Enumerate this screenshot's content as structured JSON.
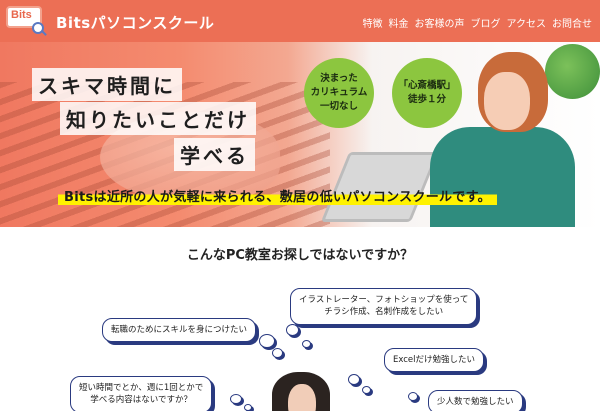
{
  "header": {
    "logo_text": "Bits",
    "title": "Bitsパソコンスクール",
    "nav": [
      "特徴",
      "料金",
      "お客様の声",
      "ブログ",
      "アクセス",
      "お問合せ"
    ]
  },
  "hero": {
    "catch_lines": [
      "スキマ時間に",
      "知りたいことだけ",
      "学べる"
    ],
    "badge1": [
      "決まった",
      "カリキュラム",
      "一切なし"
    ],
    "badge2": [
      "「心斎橋駅」",
      "徒歩１分"
    ],
    "tagline": "Bitsは近所の人が気軽に来られる、敷居の低いパソコンスクールです。"
  },
  "section": {
    "title": "こんなPC教室お探しではないですか？",
    "bubbles": [
      [
        "イラストレーター、フォトショップを使って",
        "チラシ作成、名刺作成をしたい"
      ],
      [
        "転職のためにスキルを身につけたい"
      ],
      [
        "Excelだけ勉強したい"
      ],
      [
        "短い時間でとか、週に1回とかで",
        "学べる内容はないですか？"
      ],
      [
        "少人数で勉強したい"
      ]
    ]
  },
  "colors": {
    "header_bg": "#ec6f55",
    "badge_green": "#8cc63f",
    "highlight_yellow": "#fff200",
    "bubble_border": "#2a3a80"
  }
}
